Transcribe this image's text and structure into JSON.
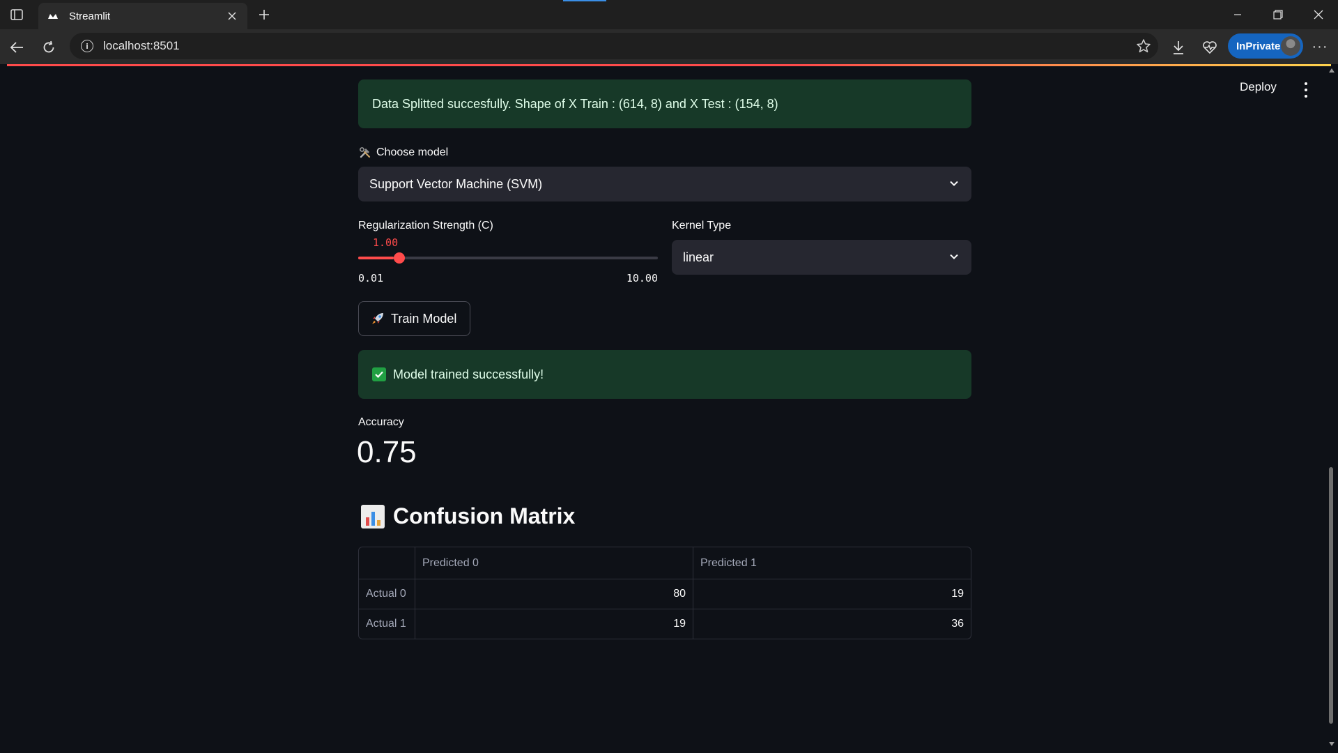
{
  "browser": {
    "tab_title": "Streamlit",
    "url": "localhost:8501",
    "inprivate_label": "InPrivate"
  },
  "app": {
    "deploy_label": "Deploy",
    "split_message": "Data Splitted succesfully. Shape of X Train : (614, 8) and X Test : (154, 8)",
    "choose_model_label": "Choose model",
    "model_selected": "Support Vector Machine (SVM)",
    "reg_label": "Regularization Strength (C)",
    "reg_value": "1.00",
    "reg_value_num": 1.0,
    "reg_min": "0.01",
    "reg_max": "10.00",
    "reg_min_num": 0.01,
    "reg_max_num": 10.0,
    "kernel_label": "Kernel Type",
    "kernel_selected": "linear",
    "train_button": "Train Model",
    "trained_message": "Model trained successfully!",
    "accuracy_label": "Accuracy",
    "accuracy_value": "0.75",
    "cm_heading": "Confusion Matrix"
  },
  "confusion_matrix": {
    "columns": [
      "Predicted 0",
      "Predicted 1"
    ],
    "rows": [
      {
        "label": "Actual 0",
        "values": [
          "80",
          "19"
        ]
      },
      {
        "label": "Actual 1",
        "values": [
          "19",
          "36"
        ]
      }
    ]
  },
  "colors": {
    "accent": "#ff4b4b",
    "success_bg": "#173928",
    "background": "#0e1117",
    "widget_bg": "#262730"
  },
  "icons": [
    "sidebar-icon",
    "streamlit-favicon",
    "close-icon",
    "plus-icon",
    "minimize-icon",
    "restore-icon",
    "back-icon",
    "refresh-icon",
    "info-icon",
    "star-icon",
    "download-icon",
    "heartbeat-icon",
    "more-icon",
    "kebab-icon",
    "tools-icon",
    "chevron-down-icon",
    "rocket-icon",
    "check-icon",
    "bar-chart-icon"
  ]
}
